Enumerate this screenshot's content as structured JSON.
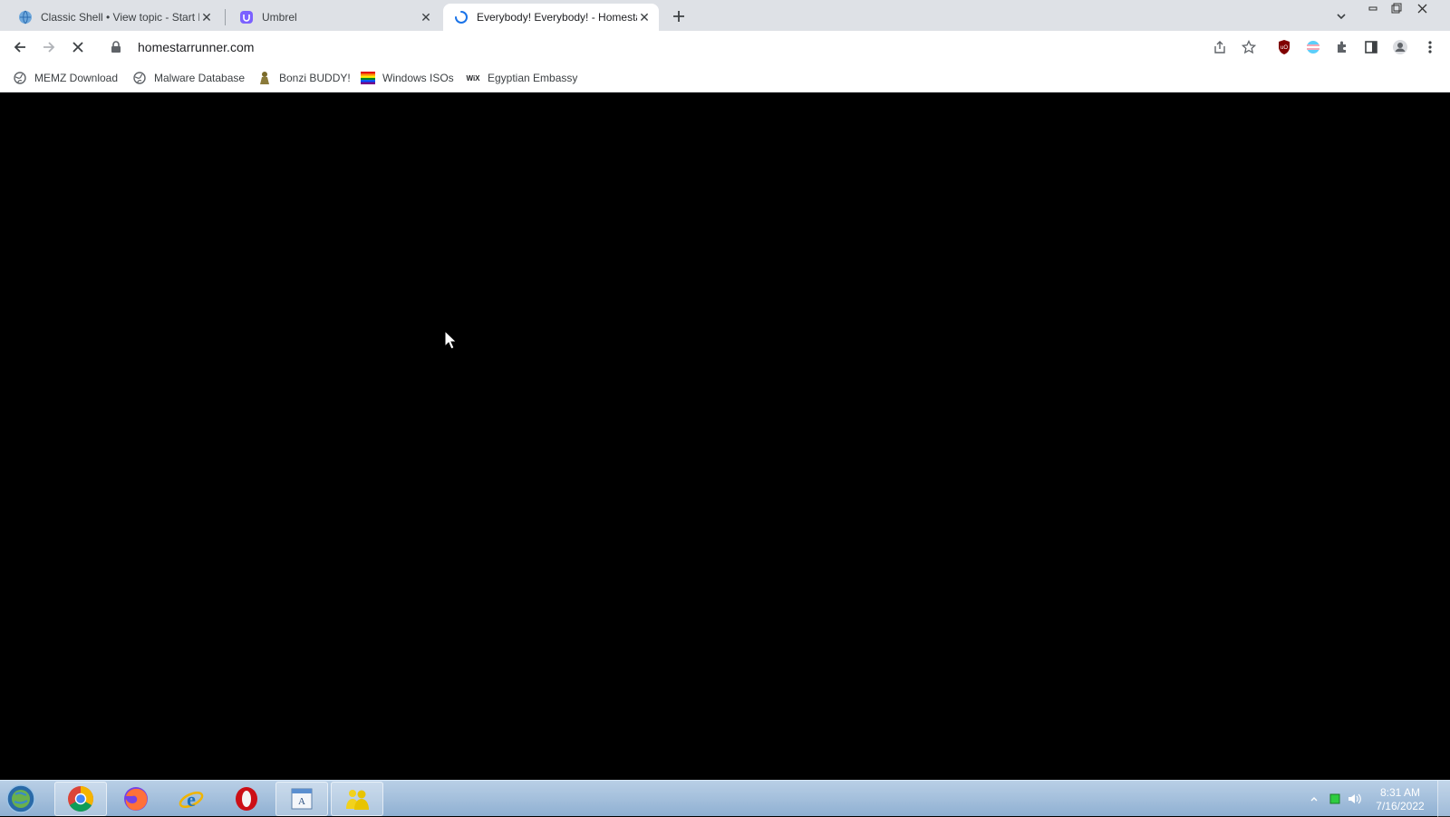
{
  "browser": {
    "tabs": [
      {
        "title": "Classic Shell • View topic - Start Menu",
        "favicon": "globe-shell-icon",
        "active": false
      },
      {
        "title": "Umbrel",
        "favicon": "umbrel-icon",
        "active": false
      },
      {
        "title": "Everybody! Everybody! - Homestar Runner",
        "favicon": "loading-spinner-icon",
        "active": true
      }
    ],
    "new_tab_label": "+",
    "address": {
      "url": "homestarrunner.com"
    },
    "bookmarks": [
      {
        "label": "MEMZ Download",
        "icon": "globe-icon"
      },
      {
        "label": "Malware Database",
        "icon": "globe-icon"
      },
      {
        "label": "Bonzi BUDDY!",
        "icon": "bonzi-icon"
      },
      {
        "label": "Windows ISOs",
        "icon": "rainbow-flag-icon"
      },
      {
        "label": "Egyptian Embassy",
        "icon": "wix-icon",
        "icon_text": "WiX"
      }
    ]
  },
  "taskbar": {
    "apps": [
      "chrome-icon",
      "firefox-icon",
      "internet-explorer-icon",
      "opera-icon",
      "wordpad-icon",
      "msn-messenger-icon"
    ],
    "clock": {
      "time": "8:31 AM",
      "date": "7/16/2022"
    }
  },
  "colors": {
    "tabstrip": "#dee1e6",
    "page_background": "#000000",
    "taskbar": "#9fbcdc"
  }
}
